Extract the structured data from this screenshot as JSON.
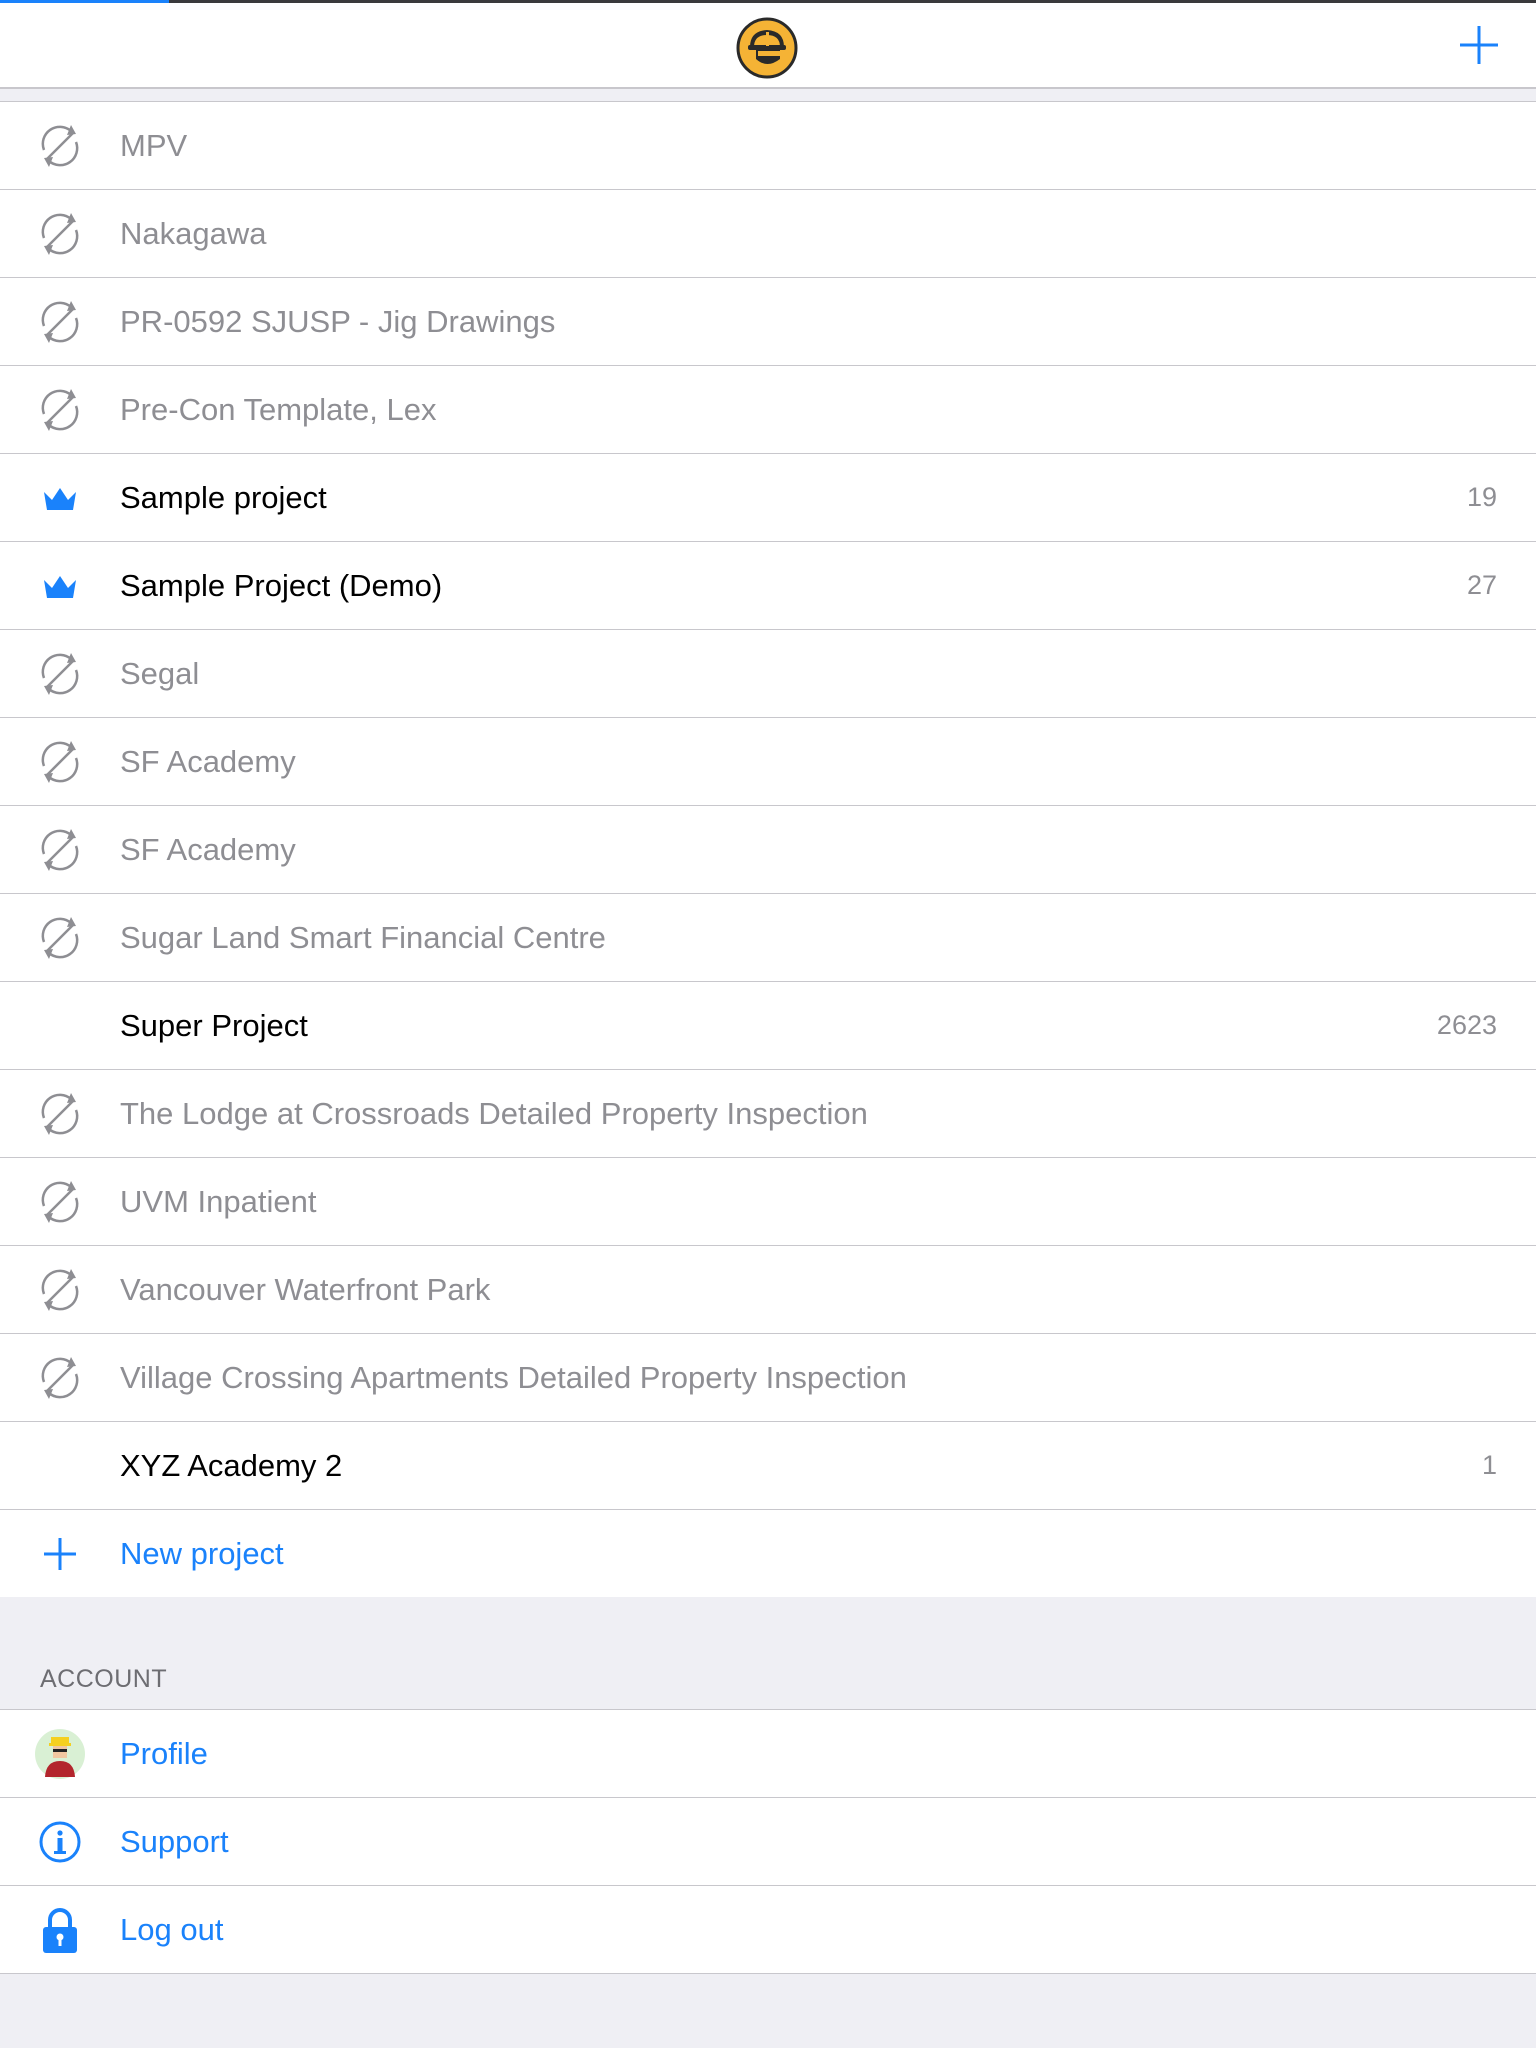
{
  "header": {
    "logo_icon": "hardhat-worker-logo-icon",
    "add_icon": "plus-icon",
    "progress": 0.11
  },
  "projects": [
    {
      "label": "MPV",
      "icon": "sync-disabled-icon",
      "active": false,
      "count": ""
    },
    {
      "label": "Nakagawa",
      "icon": "sync-disabled-icon",
      "active": false,
      "count": ""
    },
    {
      "label": "PR-0592 SJUSP - Jig Drawings",
      "icon": "sync-disabled-icon",
      "active": false,
      "count": ""
    },
    {
      "label": "Pre-Con Template, Lex",
      "icon": "sync-disabled-icon",
      "active": false,
      "count": ""
    },
    {
      "label": "Sample project",
      "icon": "crown-icon",
      "active": true,
      "count": "19"
    },
    {
      "label": "Sample Project (Demo)",
      "icon": "crown-icon",
      "active": true,
      "count": "27"
    },
    {
      "label": "Segal",
      "icon": "sync-disabled-icon",
      "active": false,
      "count": ""
    },
    {
      "label": "SF Academy",
      "icon": "sync-disabled-icon",
      "active": false,
      "count": ""
    },
    {
      "label": "SF Academy",
      "icon": "sync-disabled-icon",
      "active": false,
      "count": ""
    },
    {
      "label": "Sugar Land Smart Financial Centre",
      "icon": "sync-disabled-icon",
      "active": false,
      "count": ""
    },
    {
      "label": "Super Project",
      "icon": "",
      "active": true,
      "count": "2623"
    },
    {
      "label": "The Lodge at Crossroads Detailed Property Inspection",
      "icon": "sync-disabled-icon",
      "active": false,
      "count": ""
    },
    {
      "label": "UVM Inpatient",
      "icon": "sync-disabled-icon",
      "active": false,
      "count": ""
    },
    {
      "label": "Vancouver Waterfront Park",
      "icon": "sync-disabled-icon",
      "active": false,
      "count": ""
    },
    {
      "label": "Village Crossing Apartments Detailed Property Inspection",
      "icon": "sync-disabled-icon",
      "active": false,
      "count": ""
    },
    {
      "label": "XYZ Academy 2",
      "icon": "",
      "active": true,
      "count": "1"
    }
  ],
  "new_project": {
    "label": "New project",
    "icon": "plus-icon"
  },
  "account": {
    "header": "ACCOUNT",
    "items": [
      {
        "label": "Profile",
        "icon": "avatar-icon"
      },
      {
        "label": "Support",
        "icon": "info-icon"
      },
      {
        "label": "Log out",
        "icon": "lock-icon"
      }
    ]
  },
  "colors": {
    "accent": "#1a82fb",
    "inactive_text": "#8e8e93",
    "active_text": "#000000",
    "logo_yellow": "#f5b335",
    "background": "#efeff4"
  }
}
